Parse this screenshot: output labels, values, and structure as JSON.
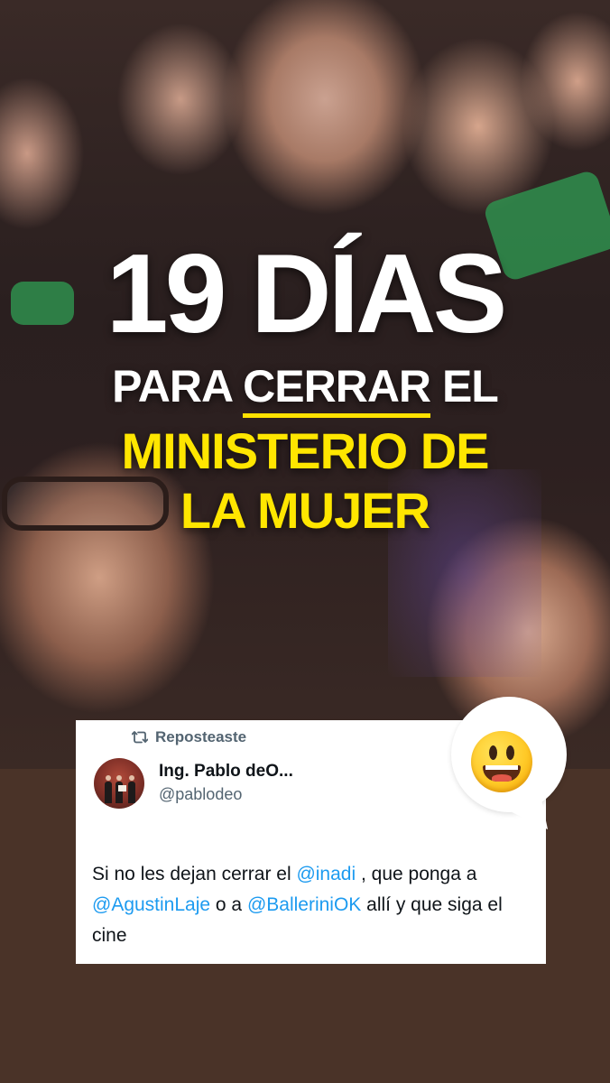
{
  "story": {
    "headline": {
      "line1": "19 DÍAS",
      "line2_prefix": "PARA ",
      "line2_underlined": "CERRAR",
      "line2_suffix": " EL",
      "line3": "MINISTERIO DE",
      "line4": "LA MUJER"
    },
    "colors": {
      "headline_white": "#ffffff",
      "headline_yellow": "#ffe600",
      "background": "#4a3328",
      "mention_blue": "#1d9bf0"
    }
  },
  "tweet": {
    "repost_label": "Reposteaste",
    "repost_icon": "repost-icon",
    "author_name": "Ing. Pablo deO...",
    "author_handle": "@pablodeo",
    "text": {
      "t1": "Si no les dejan cerrar el ",
      "m1": "@inadi",
      "t2": " , que ponga a ",
      "m2": "@AgustinLaje",
      "t3": " o a ",
      "m3": "@BalleriniOK",
      "t4": " allí y que siga el cine"
    }
  },
  "sticker": {
    "icon": "grinning-face-emoji"
  }
}
